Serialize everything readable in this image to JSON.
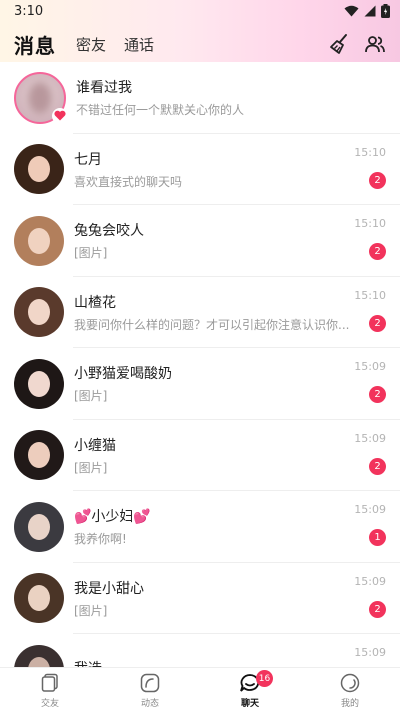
{
  "status_bar": {
    "time": "3:10"
  },
  "header": {
    "tabs": [
      {
        "label": "消息",
        "active": true
      },
      {
        "label": "密友",
        "active": false
      },
      {
        "label": "通话",
        "active": false
      }
    ],
    "actions": [
      "broom-icon",
      "contacts-icon"
    ]
  },
  "visitor": {
    "title": "谁看过我",
    "subtitle": "不错过任何一个默默关心你的人"
  },
  "conversations": [
    {
      "name": "七月",
      "message": "喜欢直接式的聊天吗",
      "time": "15:10",
      "unread": "2",
      "hair": "#3a2418",
      "face": "#efcbb8"
    },
    {
      "name": "兔兔会咬人",
      "message": "[图片]",
      "time": "15:10",
      "unread": "2",
      "hair": "#b27f5c",
      "face": "#f0d2c0"
    },
    {
      "name": "山楂花",
      "message": "我要问你什么样的问题？才可以引起你注意认识你...",
      "time": "15:10",
      "unread": "2",
      "hair": "#5a3a2c",
      "face": "#f1d6c8"
    },
    {
      "name": "小野猫爱喝酸奶",
      "message": "[图片]",
      "time": "15:09",
      "unread": "2",
      "hair": "#1e1716",
      "face": "#f0d8cf"
    },
    {
      "name": "小缠猫",
      "message": "[图片]",
      "time": "15:09",
      "unread": "2",
      "hair": "#211918",
      "face": "#edcdbd"
    },
    {
      "name": "💕小少妇💕",
      "message": "我养你啊!",
      "time": "15:09",
      "unread": "1",
      "hair": "#3b3a40",
      "face": "#e8d3c8"
    },
    {
      "name": "我是小甜心",
      "message": "[图片]",
      "time": "15:09",
      "unread": "2",
      "hair": "#4a3426",
      "face": "#ead2c2"
    },
    {
      "name": "我选",
      "message": "",
      "time": "15:09",
      "unread": "",
      "hair": "#3a3030",
      "face": "#cbb0a4"
    }
  ],
  "tabbar": {
    "items": [
      {
        "label": "交友",
        "icon": "cards-icon",
        "active": false
      },
      {
        "label": "动态",
        "icon": "moments-icon",
        "active": false
      },
      {
        "label": "聊天",
        "icon": "chat-icon",
        "active": true,
        "badge": "16"
      },
      {
        "label": "我的",
        "icon": "profile-icon",
        "active": false
      }
    ]
  },
  "colors": {
    "accent": "#f2335c",
    "badge": "#f2335c",
    "visitor_ring": "#f5669a"
  }
}
